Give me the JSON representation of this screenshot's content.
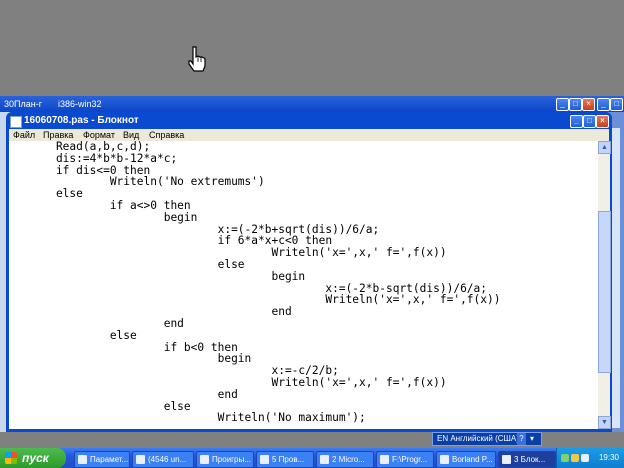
{
  "background_windows": {
    "tabs": [
      {
        "label": "30План-г"
      },
      {
        "label": "i386-win32"
      }
    ]
  },
  "notepad": {
    "title": "16060708.pas - Блокнот",
    "menu": [
      "Файл",
      "Правка",
      "Формат",
      "Вид",
      "Справка"
    ],
    "code_lines": [
      "    Read(a,b,c,d);",
      "    dis:=4*b*b-12*a*c;",
      "    if dis<=0 then",
      "            Writeln('No extremums')",
      "    else",
      "            if a<>0 then",
      "                    begin",
      "                            x:=(-2*b+sqrt(dis))/6/a;",
      "                            if 6*a*x+c<0 then",
      "                                    Writeln('x=',x,' f=',f(x))",
      "                            else",
      "                                    begin",
      "                                            x:=(-2*b-sqrt(dis))/6/a;",
      "                                            Writeln('x=',x,' f=',f(x))",
      "                                    end",
      "                    end",
      "            else",
      "                    if b<0 then",
      "                            begin",
      "                                    x:=-c/2/b;",
      "                                    Writeln('x=',x,' f=',f(x))",
      "                            end",
      "                    else",
      "                            Writeln('No maximum');"
    ]
  },
  "language_bar": {
    "label": "EN Английский (США)",
    "help": "?"
  },
  "taskbar": {
    "start_label": "пуск",
    "tasks": [
      {
        "label": "Парамет..."
      },
      {
        "label": "(4546 un..."
      },
      {
        "label": "Проигры..."
      },
      {
        "label": "5 Пров..."
      },
      {
        "label": "2 Micro..."
      },
      {
        "label": "F:\\Progr..."
      },
      {
        "label": "Borland P..."
      },
      {
        "label": "3 Блок..."
      }
    ],
    "clock": "19:30"
  },
  "colors": {
    "xp_blue": "#0a4ad0",
    "start_green": "#2e9a2e",
    "desktop_gray": "#808080"
  }
}
